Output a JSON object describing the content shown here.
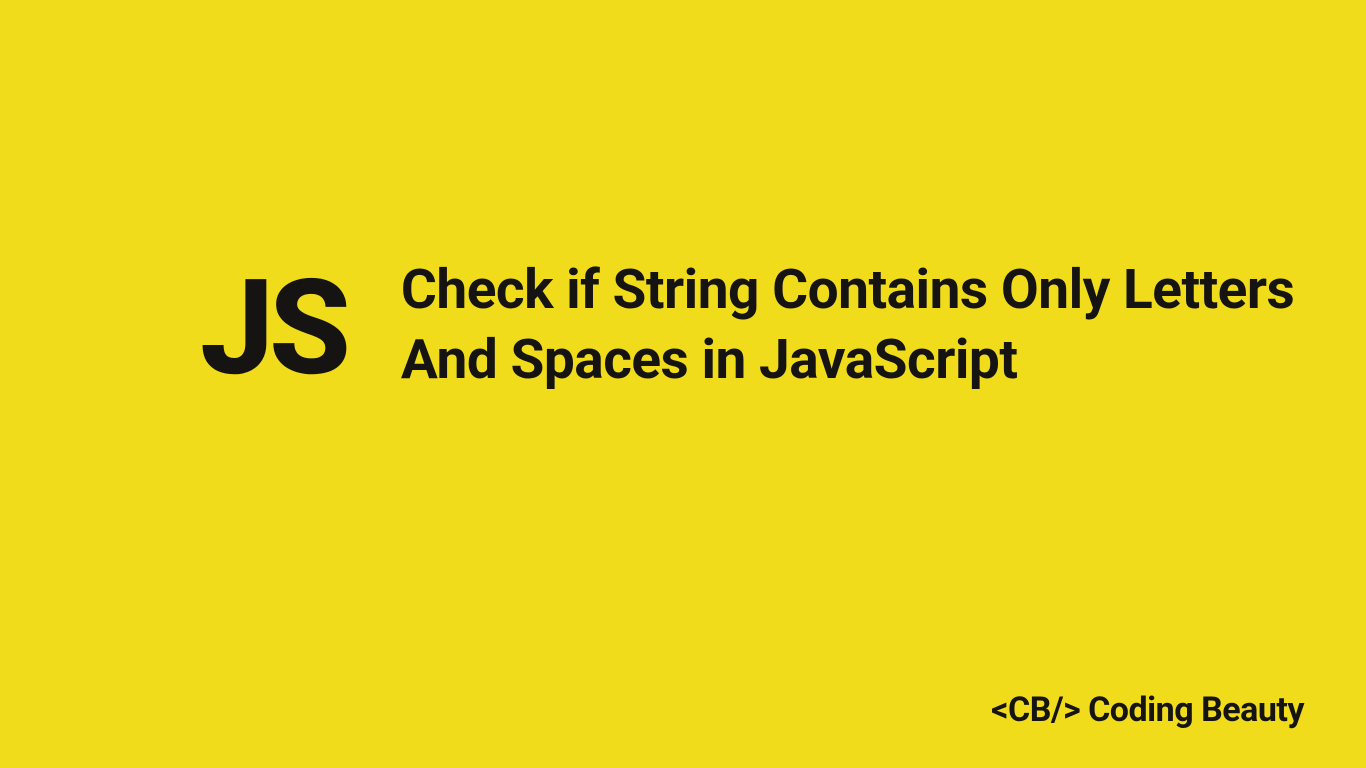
{
  "logo": {
    "text": "JS"
  },
  "title": {
    "text": "Check if String Contains Only Letters And Spaces in JavaScript"
  },
  "brand": {
    "text": "<CB/> Coding Beauty"
  }
}
